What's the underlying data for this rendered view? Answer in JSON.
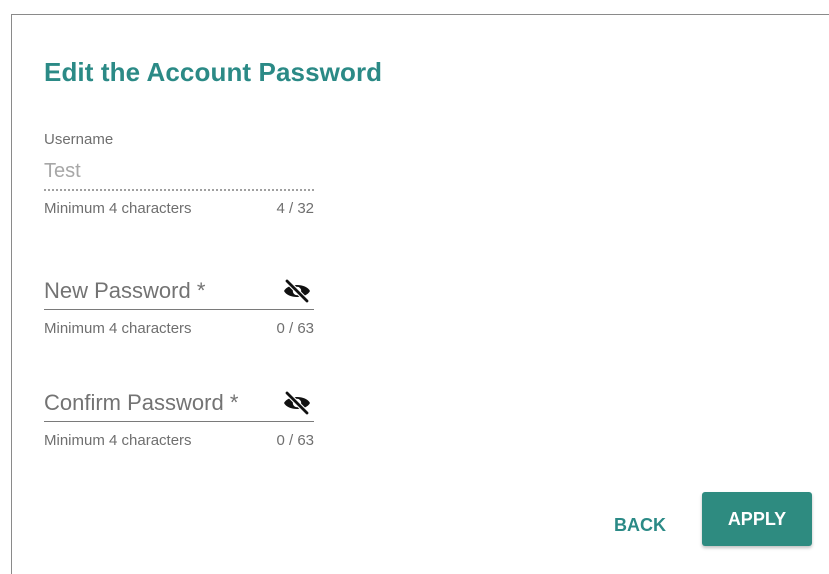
{
  "dialog": {
    "title": "Edit the Account Password"
  },
  "username": {
    "label": "Username",
    "value": "Test",
    "hint": "Minimum 4 characters",
    "counter": "4 / 32"
  },
  "new_password": {
    "label": "New Password *",
    "visibility_icon": "eye-off-icon",
    "hint": "Minimum 4 characters",
    "counter": "0 / 63"
  },
  "confirm_password": {
    "label": "Confirm Password *",
    "visibility_icon": "eye-off-icon",
    "hint": "Minimum 4 characters",
    "counter": "0 / 63"
  },
  "actions": {
    "back_label": "BACK",
    "apply_label": "APPLY"
  },
  "colors": {
    "accent": "#2b8a86",
    "primary_button": "#2e8b80"
  }
}
